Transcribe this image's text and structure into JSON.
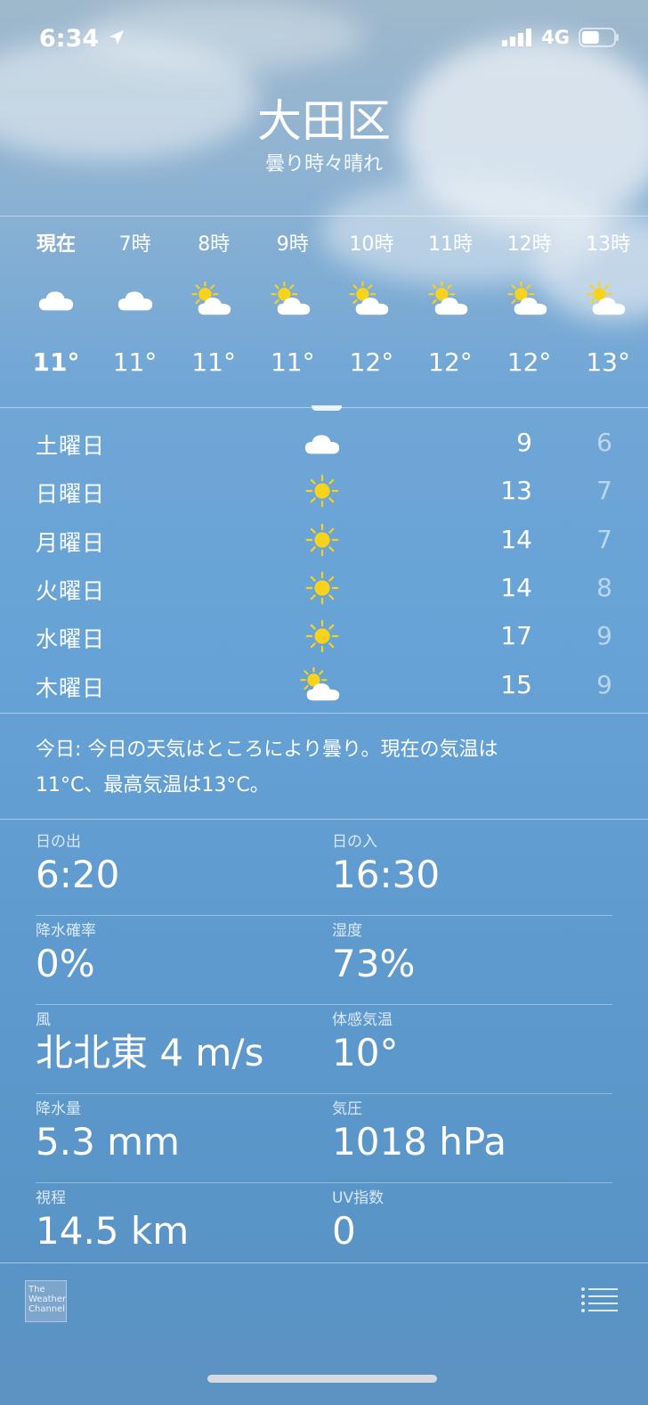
{
  "status_bar": {
    "time": "6:34",
    "network": "4G",
    "battery_percent": 55
  },
  "header": {
    "city": "大田区",
    "condition": "曇り時々晴れ"
  },
  "hourly": [
    {
      "label": "現在",
      "icon": "cloud-icon",
      "temp": "11°",
      "current": true
    },
    {
      "label": "7時",
      "icon": "cloud-icon",
      "temp": "11°"
    },
    {
      "label": "8時",
      "icon": "sun-cloud-icon",
      "temp": "11°"
    },
    {
      "label": "9時",
      "icon": "sun-cloud-icon",
      "temp": "11°"
    },
    {
      "label": "10時",
      "icon": "sun-cloud-icon",
      "temp": "12°"
    },
    {
      "label": "11時",
      "icon": "sun-cloud-icon",
      "temp": "12°"
    },
    {
      "label": "12時",
      "icon": "sun-cloud-icon",
      "temp": "12°"
    },
    {
      "label": "13時",
      "icon": "sun-cloud-icon",
      "temp": "13°"
    }
  ],
  "daily": [
    {
      "day": "土曜日",
      "icon": "cloud-icon",
      "high": "9",
      "low": "6"
    },
    {
      "day": "日曜日",
      "icon": "sun-icon",
      "high": "13",
      "low": "7"
    },
    {
      "day": "月曜日",
      "icon": "sun-icon",
      "high": "14",
      "low": "7"
    },
    {
      "day": "火曜日",
      "icon": "sun-icon",
      "high": "14",
      "low": "8"
    },
    {
      "day": "水曜日",
      "icon": "sun-icon",
      "high": "17",
      "low": "9"
    },
    {
      "day": "木曜日",
      "icon": "sun-cloud-icon",
      "high": "15",
      "low": "9"
    }
  ],
  "summary": {
    "line1": "今日: 今日の天気はところにより曇り。現在の気温は",
    "line2": "11°C、最高気温は13°C。"
  },
  "details": {
    "sunrise_label": "日の出",
    "sunrise": "6:20",
    "sunset_label": "日の入",
    "sunset": "16:30",
    "precip_chance_label": "降水確率",
    "precip_chance": "0%",
    "humidity_label": "湿度",
    "humidity": "73%",
    "wind_label": "風",
    "wind": "北北東 4 m/s",
    "feels_like_label": "体感気温",
    "feels_like": "10°",
    "precip_label": "降水量",
    "precip": "5.3 mm",
    "pressure_label": "気圧",
    "pressure": "1018 hPa",
    "visibility_label": "視程",
    "visibility": "14.5 km",
    "uv_label": "UV指数",
    "uv": "0"
  },
  "footer": {
    "logo_line1": "The",
    "logo_line2": "Weather",
    "logo_line3": "Channel"
  },
  "colors": {
    "sun": "#f9d21c",
    "cloud": "#ffffff"
  }
}
